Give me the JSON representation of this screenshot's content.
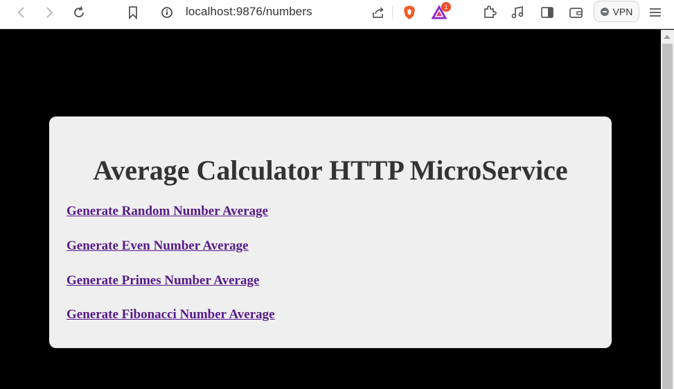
{
  "browser": {
    "url": "localhost:9876/numbers",
    "notification_count": "1",
    "vpn_label": "VPN"
  },
  "page": {
    "title": "Average Calculator HTTP MicroService",
    "links": [
      {
        "label": "Generate Random Number Average"
      },
      {
        "label": "Generate Even Number Average"
      },
      {
        "label": "Generate Primes Number Average"
      },
      {
        "label": "Generate Fibonacci Number Average"
      }
    ]
  },
  "colors": {
    "page_background": "#000000",
    "card_background": "#efefef",
    "link_visited": "#551a8b",
    "heading": "#333333"
  },
  "icons": [
    "back-icon",
    "forward-icon",
    "reload-icon",
    "bookmark-icon",
    "site-info-icon",
    "share-icon",
    "brave-shields-icon",
    "brave-rewards-icon",
    "extensions-icon",
    "media-icon",
    "sidebar-icon",
    "wallet-icon",
    "vpn-icon",
    "menu-icon"
  ]
}
